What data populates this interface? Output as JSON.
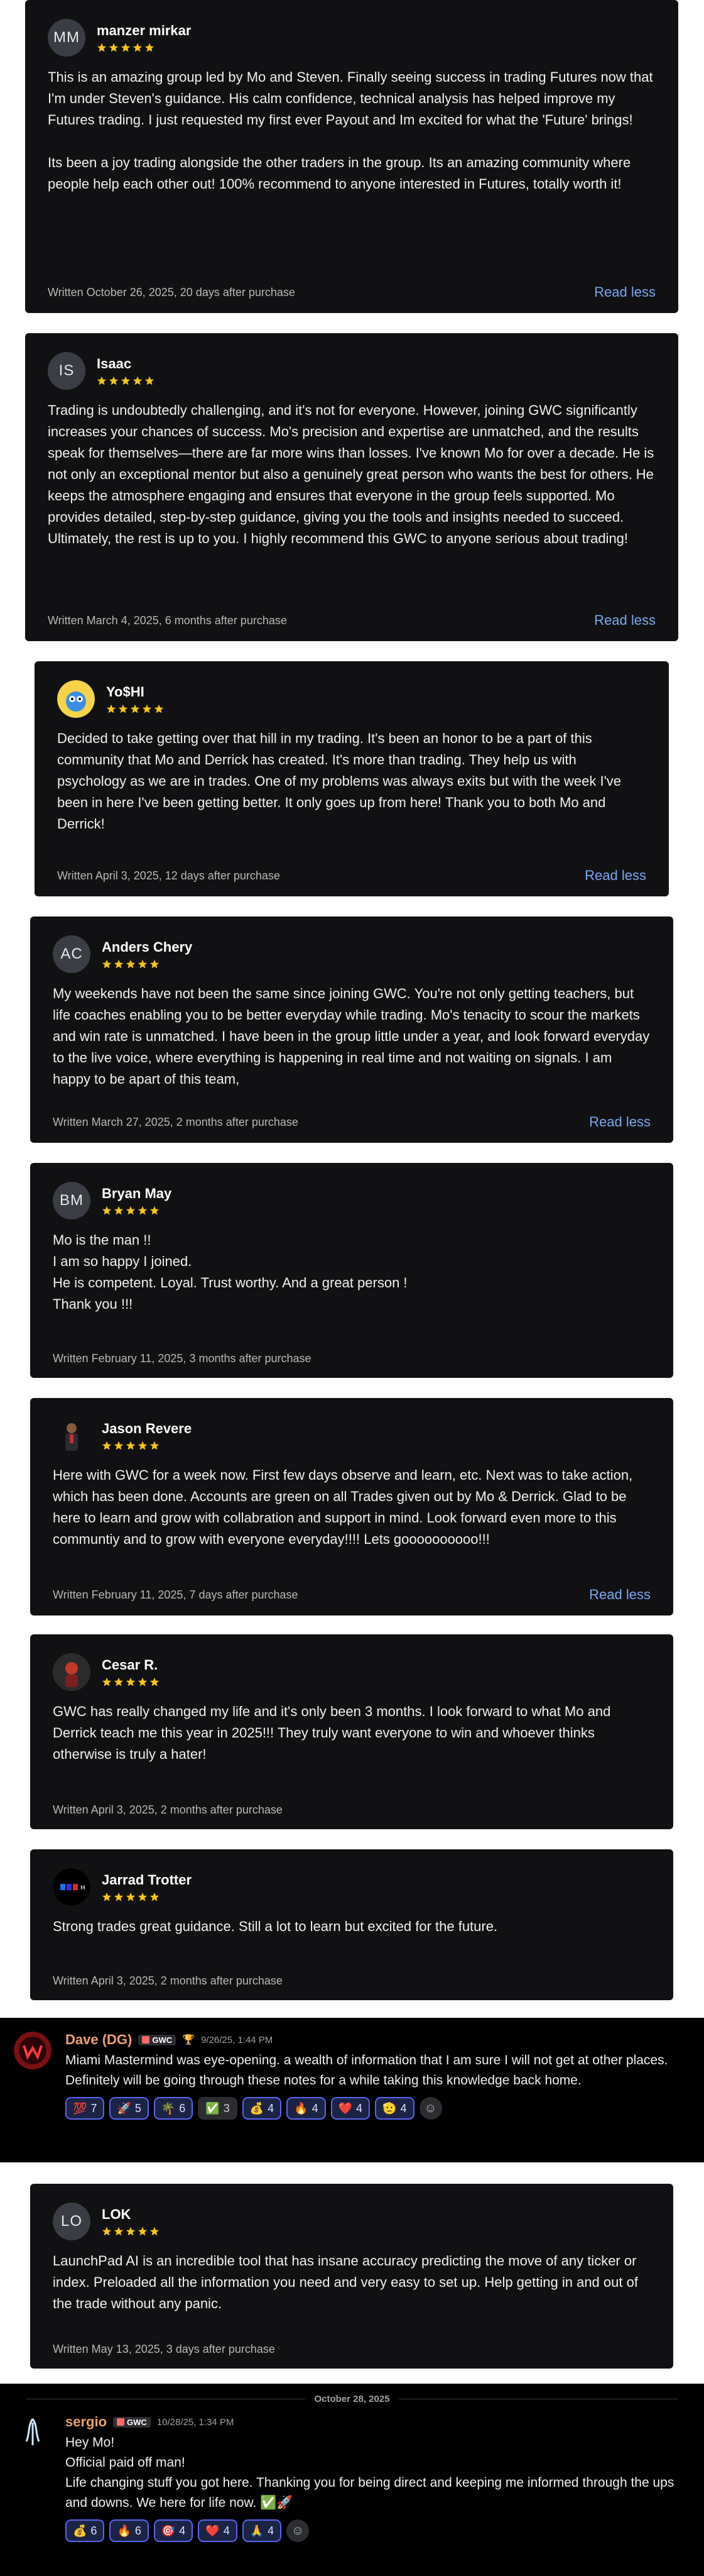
{
  "reviews": [
    {
      "initials": "MM",
      "name": "manzer mirkar",
      "rating": 5,
      "text": "This is an amazing group led by Mo and Steven. Finally seeing success in trading Futures now that I'm under Steven's guidance. His calm confidence, technical analysis has helped improve my Futures trading. I just requested my first ever Payout and Im excited for what the 'Future' brings!\n\nIts been a joy trading alongside the other traders in the group. Its an amazing community where people help each other out! 100% recommend to anyone interested in Futures, totally worth it!",
      "written": "Written October 26, 2025, 20 days after purchase",
      "action": "Read less"
    },
    {
      "initials": "IS",
      "name": "Isaac",
      "rating": 5,
      "text": "Trading is undoubtedly challenging, and it's not for everyone. However, joining GWC significantly increases your chances of success. Mo's precision and expertise are unmatched, and the results speak for themselves—there are far more wins than losses. I've known Mo for over a decade. He is not only an exceptional mentor but also a genuinely great person who wants the best for others. He keeps the atmosphere engaging and ensures that everyone in the group feels supported. Mo provides detailed, step-by-step guidance, giving you the tools and insights needed to succeed. Ultimately, the rest is up to you. I highly recommend this GWC to anyone serious about trading!",
      "written": "Written March 4, 2025, 6 months after purchase",
      "action": "Read less"
    },
    {
      "initials": "",
      "name": "Yo$HI",
      "rating": 5,
      "text": "Decided to take getting over that hill in my trading. It's been an honor to be a part of this community that Mo and Derrick has created. It's more than trading. They help us with psychology as we are in trades. One of my problems was always exits but with the week I've been in here I've been getting better. It only goes up from here! Thank you to both Mo and Derrick!",
      "written": "Written April 3, 2025, 12 days after purchase",
      "action": "Read less"
    },
    {
      "initials": "AC",
      "name": "Anders Chery",
      "rating": 5,
      "text": "My weekends have not been the same since joining GWC. You're not only getting teachers, but life coaches enabling you to be better everyday while trading. Mo's tenacity to scour the markets and win rate is unmatched. I have been in the group little under a year, and look forward everyday to the live voice, where everything is happening in real time and not waiting on signals. I am happy to be apart of this team,",
      "written": "Written March 27, 2025, 2 months after purchase",
      "action": "Read less"
    },
    {
      "initials": "BM",
      "name": "Bryan May",
      "rating": 5,
      "text": "Mo is the man !!\nI am so happy I joined.\nHe is competent. Loyal. Trust worthy. And a great person !\nThank you !!!",
      "written": "Written February 11, 2025, 3 months after purchase",
      "action": ""
    },
    {
      "initials": "",
      "name": "Jason Revere",
      "rating": 5,
      "text": "Here with GWC for a week now. First few days observe and learn, etc. Next was to take action, which has been done. Accounts are green on all Trades given out by Mo & Derrick. Glad to be here to learn and grow with collabration and support in mind. Look forward even more to this communtiy and to grow with everyone everyday!!!! Lets goooooooooo!!!",
      "written": "Written February 11, 2025, 7 days after purchase",
      "action": "Read less"
    },
    {
      "initials": "",
      "name": "Cesar R.",
      "rating": 5,
      "text": "GWC has really changed my life and it's only been 3 months. I look forward to what Mo and Derrick teach me this year in 2025!!! They truly want everyone to win and whoever thinks otherwise is truly a hater!",
      "written": "Written April 3, 2025, 2 months after purchase",
      "action": ""
    },
    {
      "initials": "",
      "name": "Jarrad Trotter",
      "rating": 5,
      "text": "Strong trades great guidance. Still a lot to learn but excited for the future.",
      "written": "Written April 3, 2025, 2 months after purchase",
      "action": ""
    },
    {
      "initials": "LO",
      "name": "LOK",
      "rating": 5,
      "text": "LaunchPad AI is an incredible tool that has insane accuracy predicting the move of any ticker or index. Preloaded all the information you need and very easy to set up. Help getting in and out of the trade without any panic.",
      "written": "Written May 13, 2025, 3 days after purchase",
      "action": ""
    }
  ],
  "discord_1": {
    "name": "Dave (DG)",
    "name_color": "#f0a070",
    "tag": "GWC",
    "time": "9/26/25, 1:44 PM",
    "text": "Miami Mastermind was eye-opening.  a wealth of information that I am sure I will not get at other places.  Definitely will be going through these notes for a while taking this knowledge back home.",
    "reactions": [
      {
        "emoji": "💯",
        "count": "7"
      },
      {
        "emoji": "🚀",
        "count": "5"
      },
      {
        "emoji": "🌴",
        "count": "6"
      },
      {
        "emoji": "✅",
        "count": "3"
      },
      {
        "emoji": "💰",
        "count": "4"
      },
      {
        "emoji": "🔥",
        "count": "4"
      },
      {
        "emoji": "❤️",
        "count": "4"
      },
      {
        "emoji": "🫡",
        "count": "4"
      }
    ]
  },
  "discord_2": {
    "date_divider": "October 28, 2025",
    "name": "sergio",
    "name_color": "#e8a36a",
    "tag": "GWC",
    "time": "10/28/25, 1:34 PM",
    "lines": [
      "Hey Mo!",
      "Official paid off man!",
      "Life changing stuff you got here. Thanking you for being direct and keeping me informed through the ups and downs. We here for life now. ✅🚀"
    ],
    "reactions": [
      {
        "emoji": "💰",
        "count": "6"
      },
      {
        "emoji": "🔥",
        "count": "6"
      },
      {
        "emoji": "🎯",
        "count": "4"
      },
      {
        "emoji": "❤️",
        "count": "4"
      },
      {
        "emoji": "🙏",
        "count": "4"
      }
    ]
  },
  "colors": {
    "card_bg": "#111113",
    "star": "#f5c518",
    "link": "#7aa7f0",
    "react_border": "#5865f2"
  }
}
